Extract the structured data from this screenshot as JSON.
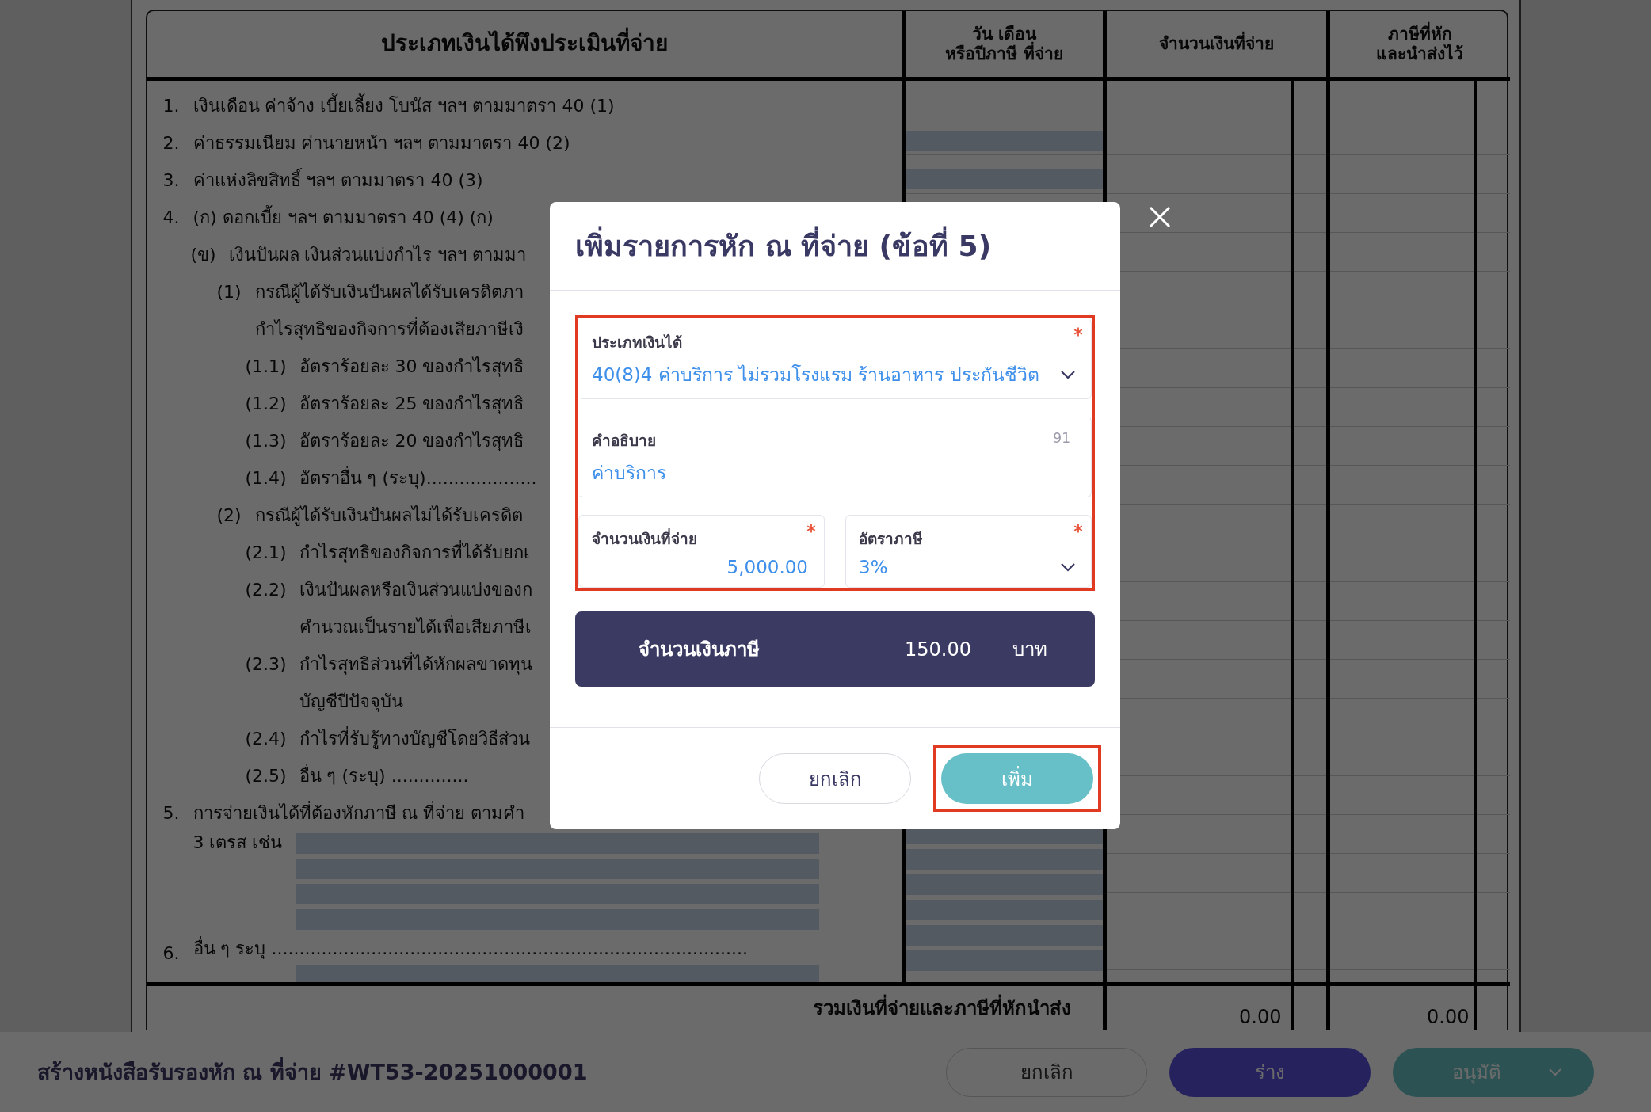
{
  "table": {
    "columns": [
      "ประเภทเงินได้พึงประเมินที่จ่าย",
      "วัน เดือน\nหรือปีภาษี ที่จ่าย",
      "จำนวนเงินที่จ่าย",
      "ภาษีที่หัก\nและนำส่งไว้"
    ],
    "items": [
      {
        "kind": "line",
        "marker": "1.",
        "lines": [
          "เงินเดือน ค่าจ้าง เบี้ยเลี้ยง โบนัส ฯลฯ ตามมาตรา 40 (1)"
        ]
      },
      {
        "kind": "line",
        "marker": "2.",
        "lines": [
          "ค่าธรรมเนียม ค่านายหน้า ฯลฯ ตามมาตรา 40 (2)"
        ]
      },
      {
        "kind": "line",
        "marker": "3.",
        "lines": [
          "ค่าแห่งลิขสิทธิ์ ฯลฯ ตามมาตรา 40 (3)"
        ]
      },
      {
        "kind": "line",
        "marker": "4.",
        "lines": [
          "(ก) ดอกเบี้ย ฯลฯ ตามมาตรา 40 (4) (ก)"
        ],
        "children": [
          {
            "kind": "line",
            "marker": "(ข)",
            "lines": [
              "เงินปันผล เงินส่วนแบ่งกำไร ฯลฯ ตามมา"
            ],
            "children": [
              {
                "kind": "line",
                "marker": "(1)",
                "lines": [
                  "กรณีผู้ได้รับเงินปันผลได้รับเครดิตภา",
                  "กำไรสุทธิของกิจการที่ต้องเสียภาษีเงิ"
                ],
                "children": [
                  {
                    "kind": "line",
                    "marker": "(1.1)",
                    "lines": [
                      "อัตราร้อยละ 30 ของกำไรสุทธิ"
                    ]
                  },
                  {
                    "kind": "line",
                    "marker": "(1.2)",
                    "lines": [
                      "อัตราร้อยละ 25 ของกำไรสุทธิ"
                    ]
                  },
                  {
                    "kind": "line",
                    "marker": "(1.3)",
                    "lines": [
                      "อัตราร้อยละ 20 ของกำไรสุทธิ"
                    ]
                  },
                  {
                    "kind": "line",
                    "marker": "(1.4)",
                    "lines": [
                      "อัตราอื่น ๆ (ระบุ)...................."
                    ]
                  }
                ]
              },
              {
                "kind": "line",
                "marker": "(2)",
                "lines": [
                  "กรณีผู้ได้รับเงินปันผลไม่ได้รับเครดิต"
                ],
                "children": [
                  {
                    "kind": "line",
                    "marker": "(2.1)",
                    "lines": [
                      "กำไรสุทธิของกิจการที่ได้รับยกเ"
                    ]
                  },
                  {
                    "kind": "line",
                    "marker": "(2.2)",
                    "lines": [
                      "เงินปันผลหรือเงินส่วนแบ่งของก",
                      "คำนวณเป็นรายได้เพื่อเสียภาษีเ"
                    ]
                  },
                  {
                    "kind": "line",
                    "marker": "(2.3)",
                    "lines": [
                      "กำไรสุทธิส่วนที่ได้หักผลขาดทุน",
                      "บัญชีปีปัจจุบัน"
                    ]
                  },
                  {
                    "kind": "line",
                    "marker": "(2.4)",
                    "lines": [
                      "กำไรที่รับรู้ทางบัญชีโดยวิธีส่วน"
                    ]
                  },
                  {
                    "kind": "line",
                    "marker": "(2.5)",
                    "lines": [
                      "อื่น ๆ (ระบุ) .............."
                    ]
                  }
                ]
              }
            ]
          }
        ]
      },
      {
        "kind": "fill",
        "marker": "5.",
        "lines": [
          "การจ่ายเงินได้ที่ต้องหักภาษี ณ ที่จ่าย ตามคำ",
          "3 เตรส เช่น"
        ]
      },
      {
        "kind": "fill",
        "marker": "6.",
        "lines": [
          "อื่น ๆ ระบุ ......................................................................................"
        ]
      }
    ],
    "footer": {
      "label": "รวมเงินที่จ่ายและภาษีที่หักนำส่ง",
      "amount": "0.00",
      "tax": "0.00"
    }
  },
  "dialog": {
    "title": "เพิ่มรายการหัก ณ ที่จ่าย (ข้อที่ 5)",
    "fields_highlighted": true,
    "fields": [
      {
        "kind": "select",
        "label": "ประเภทเงินได้",
        "value": "40(8)4 ค่าบริการ ไม่รวมโรงแรม ร้านอาหาร ประกันชีวิต",
        "required": true
      },
      {
        "kind": "text",
        "label": "คำอธิบาย",
        "value": "ค่าบริการ",
        "counter": "91",
        "required": false
      }
    ],
    "row_fields": [
      {
        "kind": "number",
        "label": "จำนวนเงินที่จ่าย",
        "value": "5,000.00",
        "required": true
      },
      {
        "kind": "select",
        "label": "อัตราภาษี",
        "value": "3%",
        "required": true
      }
    ],
    "summary": {
      "label": "จำนวนเงินภาษี",
      "amount": "150.00",
      "unit": "บาท"
    },
    "buttons": [
      {
        "kind": "secondary",
        "label": "ยกเลิก",
        "highlighted": false
      },
      {
        "kind": "primary",
        "label": "เพิ่ม",
        "highlighted": true
      }
    ]
  },
  "bottom_bar": {
    "title": "สร้างหนังสือรับรองหัก ณ ที่จ่าย #WT53-20251000001",
    "buttons": [
      {
        "kind": "outline",
        "label": "ยกเลิก"
      },
      {
        "kind": "primary",
        "label": "ร่าง"
      },
      {
        "kind": "split",
        "label": "อนุมัติ"
      }
    ]
  }
}
